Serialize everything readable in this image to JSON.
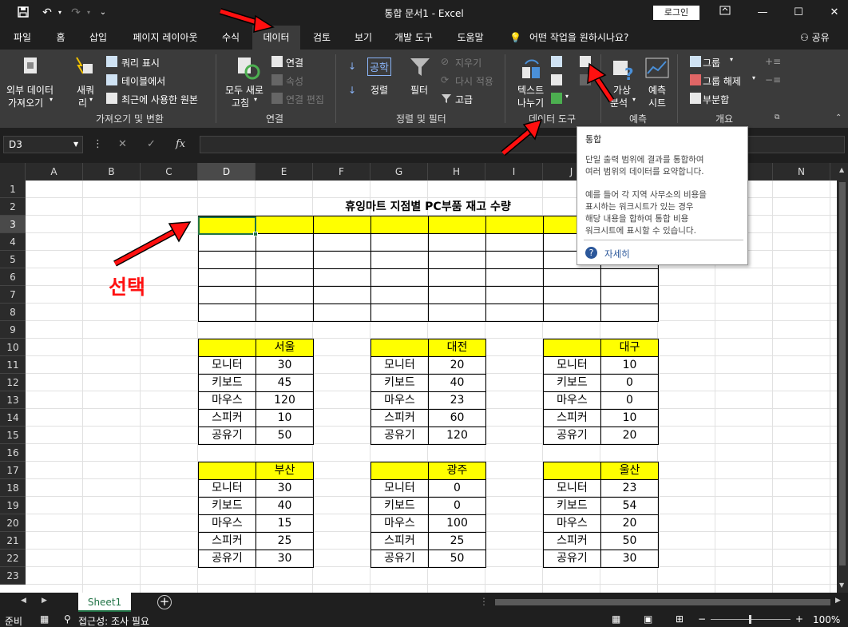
{
  "titlebar": {
    "title": "통합 문서1  -  Excel",
    "login": "로그인"
  },
  "tabs": [
    "파일",
    "홈",
    "삽입",
    "페이지 레이아웃",
    "수식",
    "데이터",
    "검토",
    "보기",
    "개발 도구",
    "도움말"
  ],
  "active_tab": "데이터",
  "tell_me": "어떤 작업을 원하시나요?",
  "share": "공유",
  "ribbon": {
    "get_data": {
      "external_line1": "외부 데이터",
      "external_line2": "가져오기",
      "new_query_line1": "새쿼",
      "new_query_line2": "리",
      "show_queries": "쿼리 표시",
      "from_table": "테이블에서",
      "recent_sources": "최근에 사용한 원본",
      "group_label": "가져오기 및 변환"
    },
    "connections": {
      "refresh_line1": "모두 새로",
      "refresh_line2": "고침",
      "connections": "연결",
      "properties": "속성",
      "edit_links": "연결 편집",
      "group_label": "연결"
    },
    "sort_filter": {
      "sort_az_icon_text": "공학",
      "sort": "정렬",
      "filter": "필터",
      "clear": "지우기",
      "reapply": "다시 적용",
      "advanced": "고급",
      "group_label": "정렬 및 필터"
    },
    "data_tools": {
      "text_to_columns_line1": "텍스트",
      "text_to_columns_line2": "나누기",
      "group_label": "데이터 도구"
    },
    "forecast": {
      "what_if_line1": "가상",
      "what_if_line2": "분석",
      "forecast_sheet_line1": "예측",
      "forecast_sheet_line2": "시트",
      "group_label": "예측"
    },
    "outline": {
      "group": "그룹",
      "ungroup": "그룹 해제",
      "subtotal": "부분합",
      "group_label": "개요"
    }
  },
  "formula_bar": {
    "name_box": "D3",
    "fx": "fx"
  },
  "columns": [
    "A",
    "B",
    "C",
    "D",
    "E",
    "F",
    "G",
    "H",
    "I",
    "J",
    "K",
    "L",
    "M",
    "N"
  ],
  "rows": [
    "1",
    "2",
    "3",
    "4",
    "5",
    "6",
    "7",
    "8",
    "9",
    "10",
    "11",
    "12",
    "13",
    "14",
    "15",
    "16",
    "17",
    "18",
    "19",
    "20",
    "21",
    "22",
    "23"
  ],
  "sheet": {
    "title": "휴잉마트 지점별 PC부품 재고 수량",
    "tables": [
      {
        "city": "서울",
        "items": [
          [
            "모니터",
            "30"
          ],
          [
            "키보드",
            "45"
          ],
          [
            "마우스",
            "120"
          ],
          [
            "스피커",
            "10"
          ],
          [
            "공유기",
            "50"
          ]
        ]
      },
      {
        "city": "대전",
        "items": [
          [
            "모니터",
            "20"
          ],
          [
            "키보드",
            "40"
          ],
          [
            "마우스",
            "23"
          ],
          [
            "스피커",
            "60"
          ],
          [
            "공유기",
            "120"
          ]
        ]
      },
      {
        "city": "대구",
        "items": [
          [
            "모니터",
            "10"
          ],
          [
            "키보드",
            "0"
          ],
          [
            "마우스",
            "0"
          ],
          [
            "스피커",
            "10"
          ],
          [
            "공유기",
            "20"
          ]
        ]
      },
      {
        "city": "부산",
        "items": [
          [
            "모니터",
            "30"
          ],
          [
            "키보드",
            "40"
          ],
          [
            "마우스",
            "15"
          ],
          [
            "스피커",
            "25"
          ],
          [
            "공유기",
            "30"
          ]
        ]
      },
      {
        "city": "광주",
        "items": [
          [
            "모니터",
            "0"
          ],
          [
            "키보드",
            "0"
          ],
          [
            "마우스",
            "100"
          ],
          [
            "스피커",
            "25"
          ],
          [
            "공유기",
            "50"
          ]
        ]
      },
      {
        "city": "울산",
        "items": [
          [
            "모니터",
            "23"
          ],
          [
            "키보드",
            "54"
          ],
          [
            "마우스",
            "20"
          ],
          [
            "스피커",
            "50"
          ],
          [
            "공유기",
            "30"
          ]
        ]
      }
    ]
  },
  "sheet_tab": "Sheet1",
  "status": {
    "ready": "준비",
    "accessibility": "접근성: 조사 필요",
    "zoom": "100%"
  },
  "tooltip": {
    "title": "통합",
    "desc1": "단일 출력 범위에 결과를 통합하여",
    "desc2": "여러 범위의 데이터를 요약합니다.",
    "ex1": "예를 들어 각 지역 사무소의 비용을",
    "ex2": "표시하는 워크시트가 있는 경우",
    "ex3": "해당 내용을 합하여 통합 비용",
    "ex4": "워크시트에 표시할 수 있습니다.",
    "more": "자세히"
  },
  "annotation": {
    "label": "선택",
    "color": "#ff1010"
  },
  "colors": {
    "accent": "#217346",
    "highlight": "#ffff00",
    "ribbon": "#3b3b3b"
  }
}
